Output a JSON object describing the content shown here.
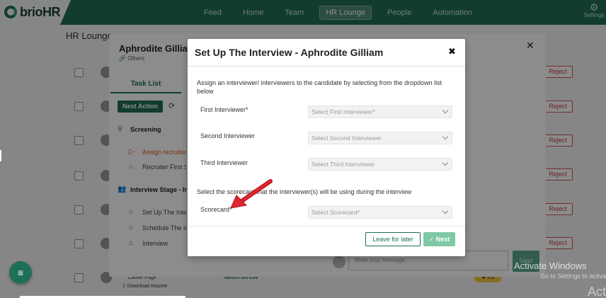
{
  "app": {
    "brand_prefix": "brio",
    "brand_suffix": "HR"
  },
  "nav": {
    "items": [
      "Feed",
      "Home",
      "Team",
      "HR Lounge",
      "People",
      "Automation"
    ],
    "active": "HR Lounge",
    "settings_label": "Settings"
  },
  "page": {
    "title": "HR Lounge"
  },
  "candidate_panel": {
    "name": "Aphrodite Gilliam",
    "subtitle": "Others",
    "tab_label": "Task List",
    "next_action_label": "Next Action",
    "sections": [
      {
        "title": "Screening",
        "items": [
          "Assign recruiter",
          "Recruiter First Sc"
        ]
      },
      {
        "title": "Interview Stage - Int",
        "items": [
          "Set Up The Interv",
          "Schedule The Int",
          "Interview"
        ]
      }
    ],
    "message_placeholder": "Write your message",
    "send_label": "Send"
  },
  "background_rows": {
    "reject_label": "Reject",
    "career_page": "Career Page",
    "download_resume": "Download resume",
    "negotiation": "NEGOTIATION",
    "rating": "3.8"
  },
  "modal": {
    "title": "Set Up The Interview - Aphrodite Gilliam",
    "description": "Assign an interviewer/ interviewers to the candidate by selecting from the dropdown list below",
    "fields": [
      {
        "label": "First Interviewer*",
        "placeholder": "Select First Interviewer*"
      },
      {
        "label": "Second Interviewer",
        "placeholder": "Select Second Interviewer"
      },
      {
        "label": "Third Interviewer",
        "placeholder": "Select Third Interviewer"
      }
    ],
    "scorecard_description": "Select the scorecard that the interviewer(s) will be using during the interview",
    "scorecard": {
      "label": "Scorecard*",
      "placeholder": "Select Scorecard*"
    },
    "leave_label": "Leave for later",
    "next_label": "Next"
  },
  "watermark": {
    "line1": "Activate Windows",
    "line2": "Go to Settings to activate Wi",
    "line3": "Act"
  },
  "colors": {
    "brand_green": "#1f6e57",
    "next_disabled": "#7fc9a6",
    "reject_red": "#c43c3c",
    "annotation_arrow": "#d4202a"
  }
}
